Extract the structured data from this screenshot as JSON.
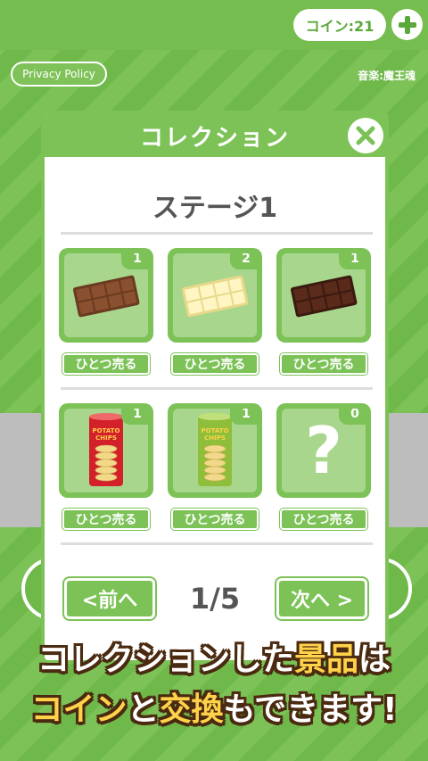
{
  "header": {
    "coin_label": "コイン:21",
    "plus_icon": "plus-icon"
  },
  "privacy_label": "Privacy Policy",
  "music_credit": "音楽:魔王魂",
  "modal": {
    "title": "コレクション",
    "close_icon": "close-icon",
    "stage_title": "ステージ1",
    "items": [
      {
        "name": "milk-chocolate",
        "count": "1",
        "sell_label": "ひとつ売る",
        "icon": "milk-chocolate-icon"
      },
      {
        "name": "white-chocolate",
        "count": "2",
        "sell_label": "ひとつ売る",
        "icon": "white-chocolate-icon"
      },
      {
        "name": "dark-chocolate",
        "count": "1",
        "sell_label": "ひとつ売る",
        "icon": "dark-chocolate-icon"
      },
      {
        "name": "potato-chips-red",
        "count": "1",
        "sell_label": "ひとつ売る",
        "icon": "potato-chips-red-icon",
        "chip_text_1": "POTATO",
        "chip_text_2": "CHIPS"
      },
      {
        "name": "potato-chips-green",
        "count": "1",
        "sell_label": "ひとつ売る",
        "icon": "potato-chips-green-icon",
        "chip_text_1": "POTATO",
        "chip_text_2": "CHIPS"
      },
      {
        "name": "unknown-item",
        "count": "0",
        "sell_label": "ひとつ売る",
        "icon": "question-mark-icon",
        "glyph": "?"
      }
    ],
    "prev_label": "<前へ",
    "next_label": "次へ >",
    "page_indicator": "1/5"
  },
  "promo": {
    "line1_a": "コレクションした",
    "line1_b": "景品",
    "line1_c": "は",
    "line2_a": "コイン",
    "line2_b": "と",
    "line2_c": "交換",
    "line2_d": "もできます!"
  },
  "colors": {
    "brand_green": "#7cc257",
    "highlight_yellow": "#ffd24a",
    "outline_brown": "#4a2a10"
  }
}
